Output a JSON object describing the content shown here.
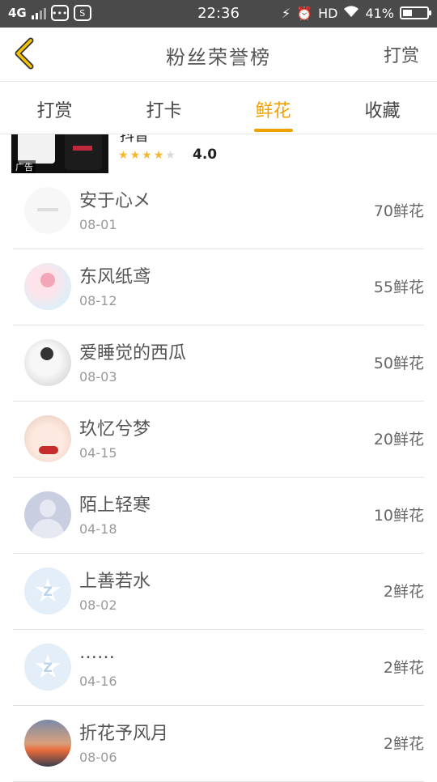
{
  "status_bar": {
    "network": "4G",
    "time": "22:36",
    "hd": "HD",
    "battery": "41%",
    "battery_level": 0.41,
    "icons": [
      "signal-icon",
      "message-icon",
      "screenshot-icon",
      "battery-saver-icon",
      "alarm-icon",
      "wifi-icon",
      "battery-icon"
    ]
  },
  "header": {
    "title": "粉丝荣誉榜",
    "action": "打赏"
  },
  "tabs": [
    {
      "label": "打赏",
      "active": false
    },
    {
      "label": "打卡",
      "active": false
    },
    {
      "label": "鲜花",
      "active": true
    },
    {
      "label": "收藏",
      "active": false
    }
  ],
  "ad": {
    "app_name": "抖音",
    "tag": "广告",
    "rating": "4.0",
    "stars": 4
  },
  "fans": [
    {
      "name": "安于心メ",
      "date": "08-01",
      "amount": "70鲜花"
    },
    {
      "name": "东风纸鸢",
      "date": "08-12",
      "amount": "55鲜花"
    },
    {
      "name": "爱睡觉的西瓜",
      "date": "08-03",
      "amount": "50鲜花"
    },
    {
      "name": "玖忆兮梦",
      "date": "04-15",
      "amount": "20鲜花"
    },
    {
      "name": "陌上轻寒",
      "date": "04-18",
      "amount": "10鲜花"
    },
    {
      "name": "上善若水",
      "date": "08-02",
      "amount": "2鲜花"
    },
    {
      "name": "……",
      "date": "04-16",
      "amount": "2鲜花"
    },
    {
      "name": "折花予风月",
      "date": "08-06",
      "amount": "2鲜花"
    }
  ],
  "colors": {
    "accent": "#f0a100",
    "status_bar": "#4a4a4a",
    "star": "#f5b82e"
  }
}
